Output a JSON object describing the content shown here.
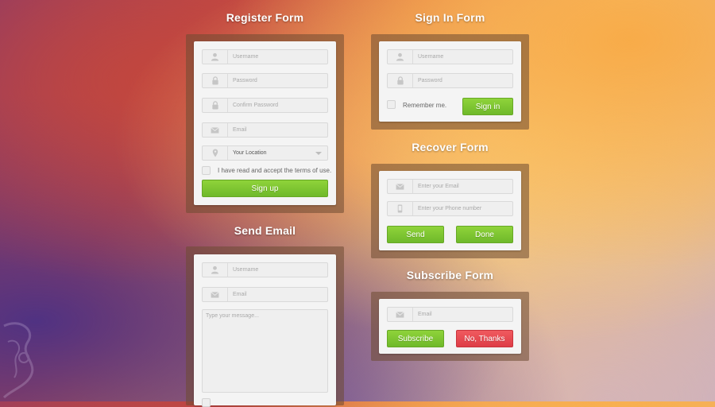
{
  "register": {
    "title": "Register Form",
    "username_placeholder": "Username",
    "password_placeholder": "Password",
    "confirm_placeholder": "Confirm Password",
    "email_placeholder": "Email",
    "location_value": "Your Location",
    "terms_label": "I have read and accept the terms of use.",
    "signup_label": "Sign up"
  },
  "signin": {
    "title": "Sign In Form",
    "username_placeholder": "Username",
    "password_placeholder": "Password",
    "remember_label": "Remember me.",
    "signin_label": "Sign in"
  },
  "recover": {
    "title": "Recover Form",
    "email_placeholder": "Enter your Email",
    "phone_placeholder": "Enter your Phone number",
    "send_label": "Send",
    "done_label": "Done"
  },
  "send_email": {
    "title": "Send Email",
    "username_placeholder": "Username",
    "email_placeholder": "Email",
    "message_placeholder": "Type your message..."
  },
  "subscribe": {
    "title": "Subscribe Form",
    "email_placeholder": "Email",
    "subscribe_label": "Subscribe",
    "no_thanks_label": "No, Thanks"
  },
  "colors": {
    "green_button": "#7cc531",
    "red_button": "#e84a51"
  },
  "icons": [
    "user-icon",
    "lock-icon",
    "envelope-icon",
    "location-pin-icon",
    "phone-icon",
    "chevron-down-icon"
  ]
}
